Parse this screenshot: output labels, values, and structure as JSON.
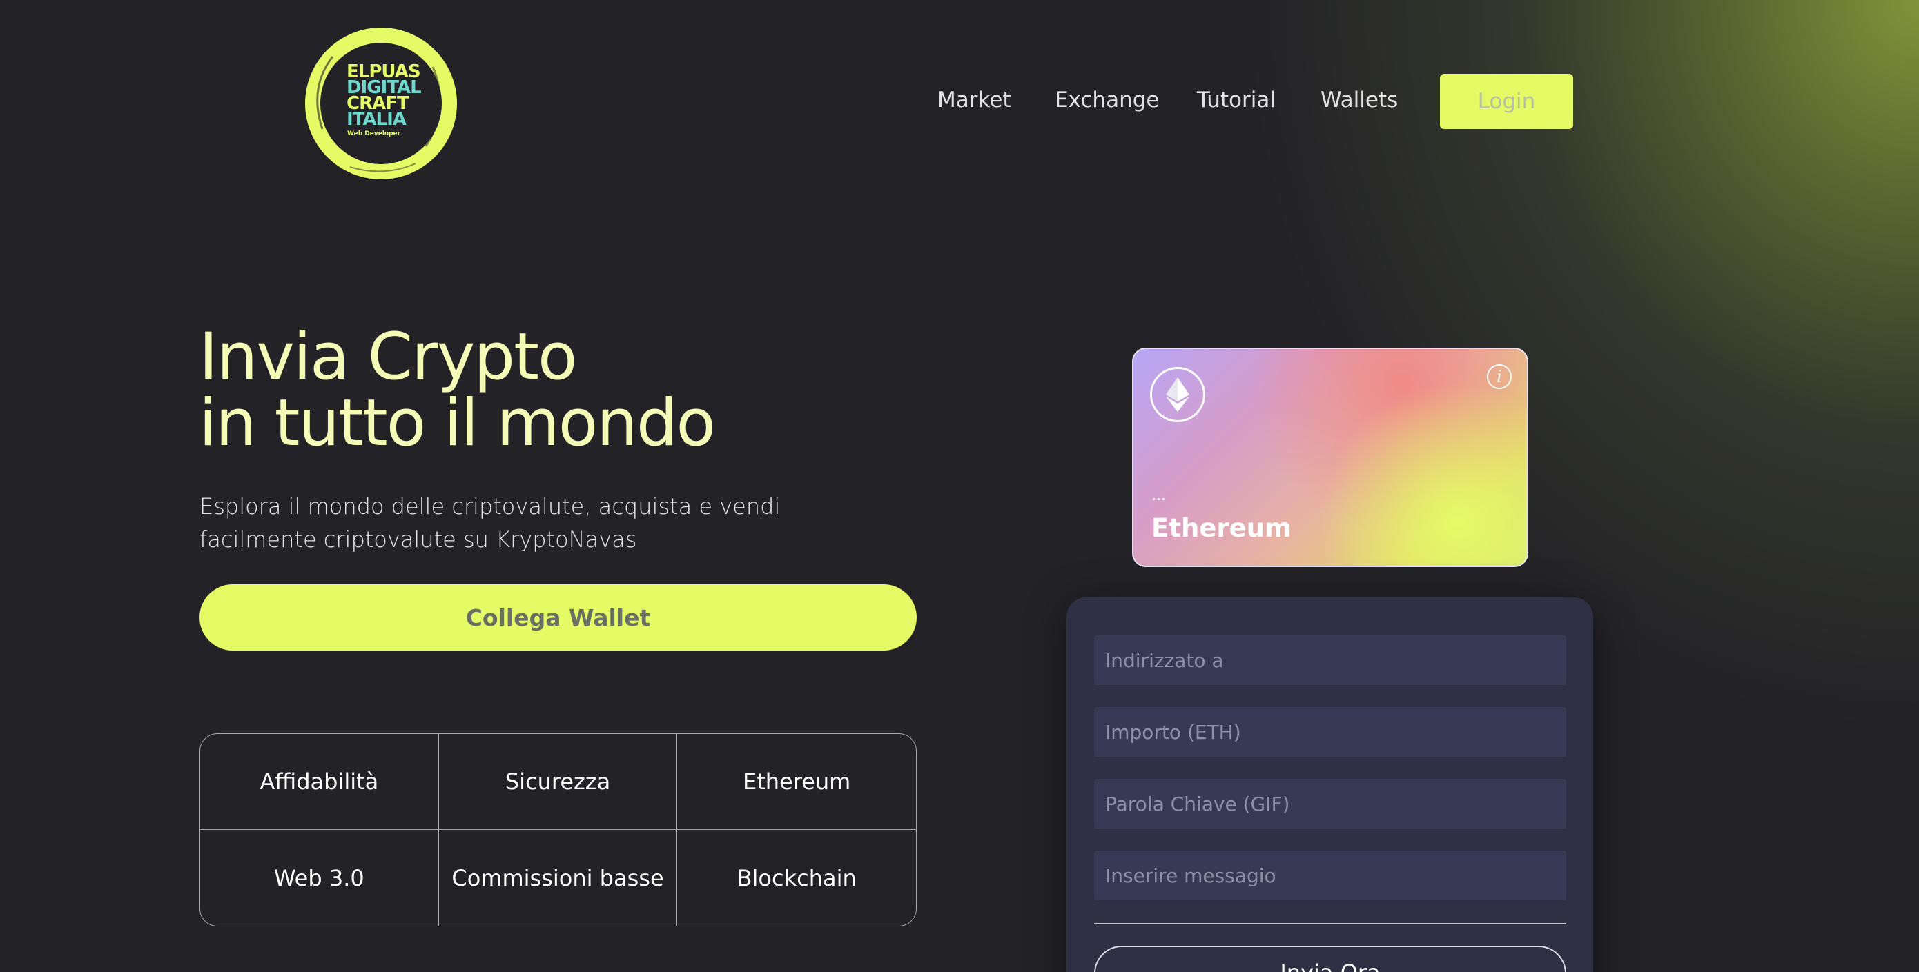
{
  "logo": {
    "line1": "ELPUAS",
    "line2": "DIGITAL",
    "line3": "CRAFT",
    "line4": "ITALIA",
    "subtitle": "Web Developer"
  },
  "nav": {
    "items": [
      "Market",
      "Exchange",
      "Tutorial",
      "Wallets"
    ],
    "login_label": "Login"
  },
  "hero": {
    "title_line1": "Invia Crypto",
    "title_line2": "in tutto il mondo",
    "description": "Esplora il mondo delle criptovalute, acquista e vendi facilmente criptovalute su KryptoNavas",
    "connect_label": "Collega Wallet"
  },
  "features": [
    "Affidabilità",
    "Sicurezza",
    "Ethereum",
    "Web 3.0",
    "Commissioni basse",
    "Blockchain"
  ],
  "card": {
    "address": "...",
    "name": "Ethereum",
    "info_glyph": "i"
  },
  "form": {
    "address_placeholder": "Indirizzato a",
    "amount_placeholder": "Importo (ETH)",
    "keyword_placeholder": "Parola Chiave (GIF)",
    "message_placeholder": "Inserire messagio",
    "send_label": "Invia Ora"
  },
  "colors": {
    "accent": "#e4fb66",
    "background": "#232227",
    "form_panel": "#2f3044",
    "field_bg": "#363a55",
    "title": "#f4fbb6"
  }
}
